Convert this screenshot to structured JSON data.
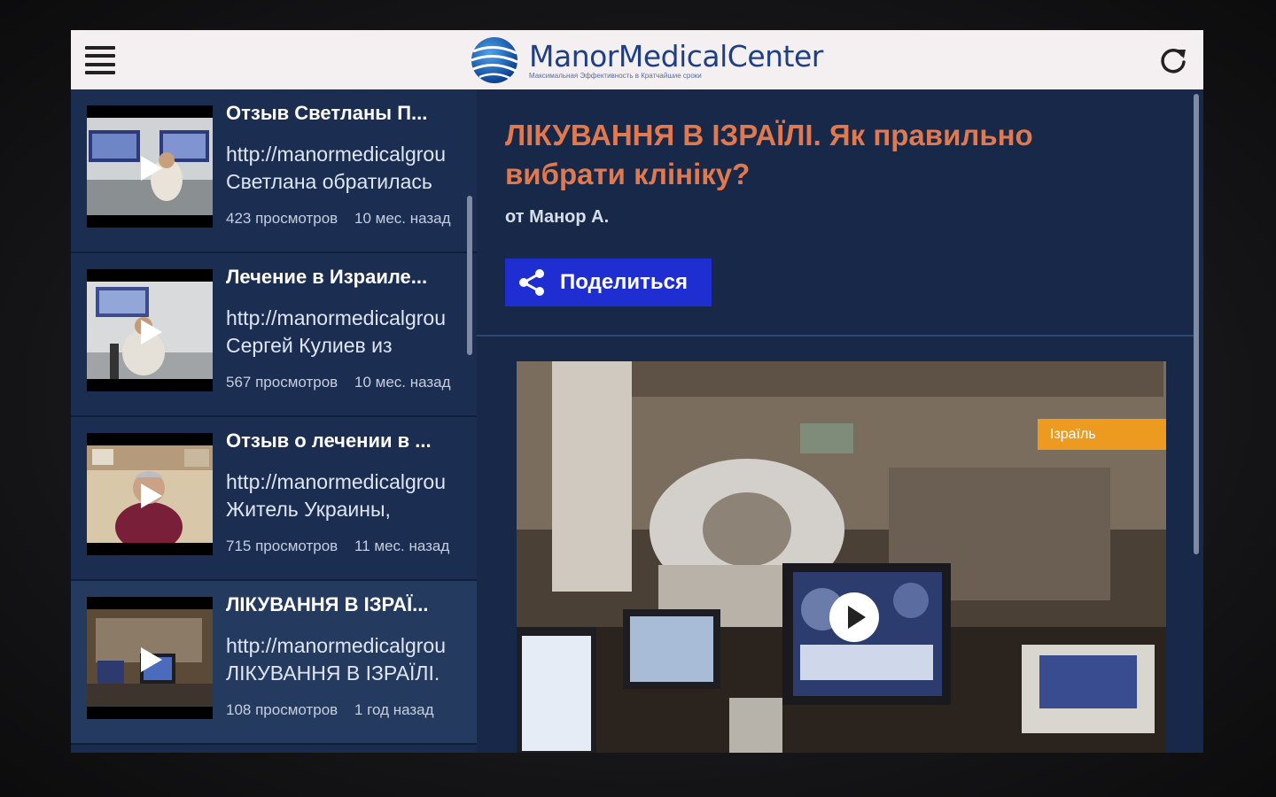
{
  "header": {
    "logo_title": "ManorMedicalCenter",
    "logo_subtitle": "Максимальная Эффективность в Кратчайшие сроки"
  },
  "videos": [
    {
      "title": "Отзыв Светланы П...",
      "url": "http://manormedicalgrou",
      "desc": "Светлана обратилась",
      "views": "423 просмотров",
      "age": "10 мес. назад"
    },
    {
      "title": "Лечение в Израиле...",
      "url": "http://manormedicalgrou",
      "desc": "Сергей Кулиев из",
      "views": "567 просмотров",
      "age": "10 мес. назад"
    },
    {
      "title": "Отзыв о лечении в ...",
      "url": "http://manormedicalgrou",
      "desc": "Житель Украины,",
      "views": "715 просмотров",
      "age": "11 мес. назад"
    },
    {
      "title": "ЛІКУВАННЯ В ІЗРАЇ...",
      "url": "http://manormedicalgrou",
      "desc": "ЛІКУВАННЯ В ІЗРАЇЛІ.",
      "views": "108 просмотров",
      "age": "1 год назад"
    }
  ],
  "detail": {
    "title": "ЛІКУВАННЯ В ІЗРАЇЛІ. Як правильно вибрати клініку?",
    "author": "от Манор А.",
    "share_label": "Поделиться",
    "tag": "Ізраїль"
  },
  "colors": {
    "accent_title": "#e0794f",
    "share_button": "#1f2ed1",
    "tag_badge": "#ec9a20",
    "background": "#182848"
  },
  "selected_video_index": 3
}
